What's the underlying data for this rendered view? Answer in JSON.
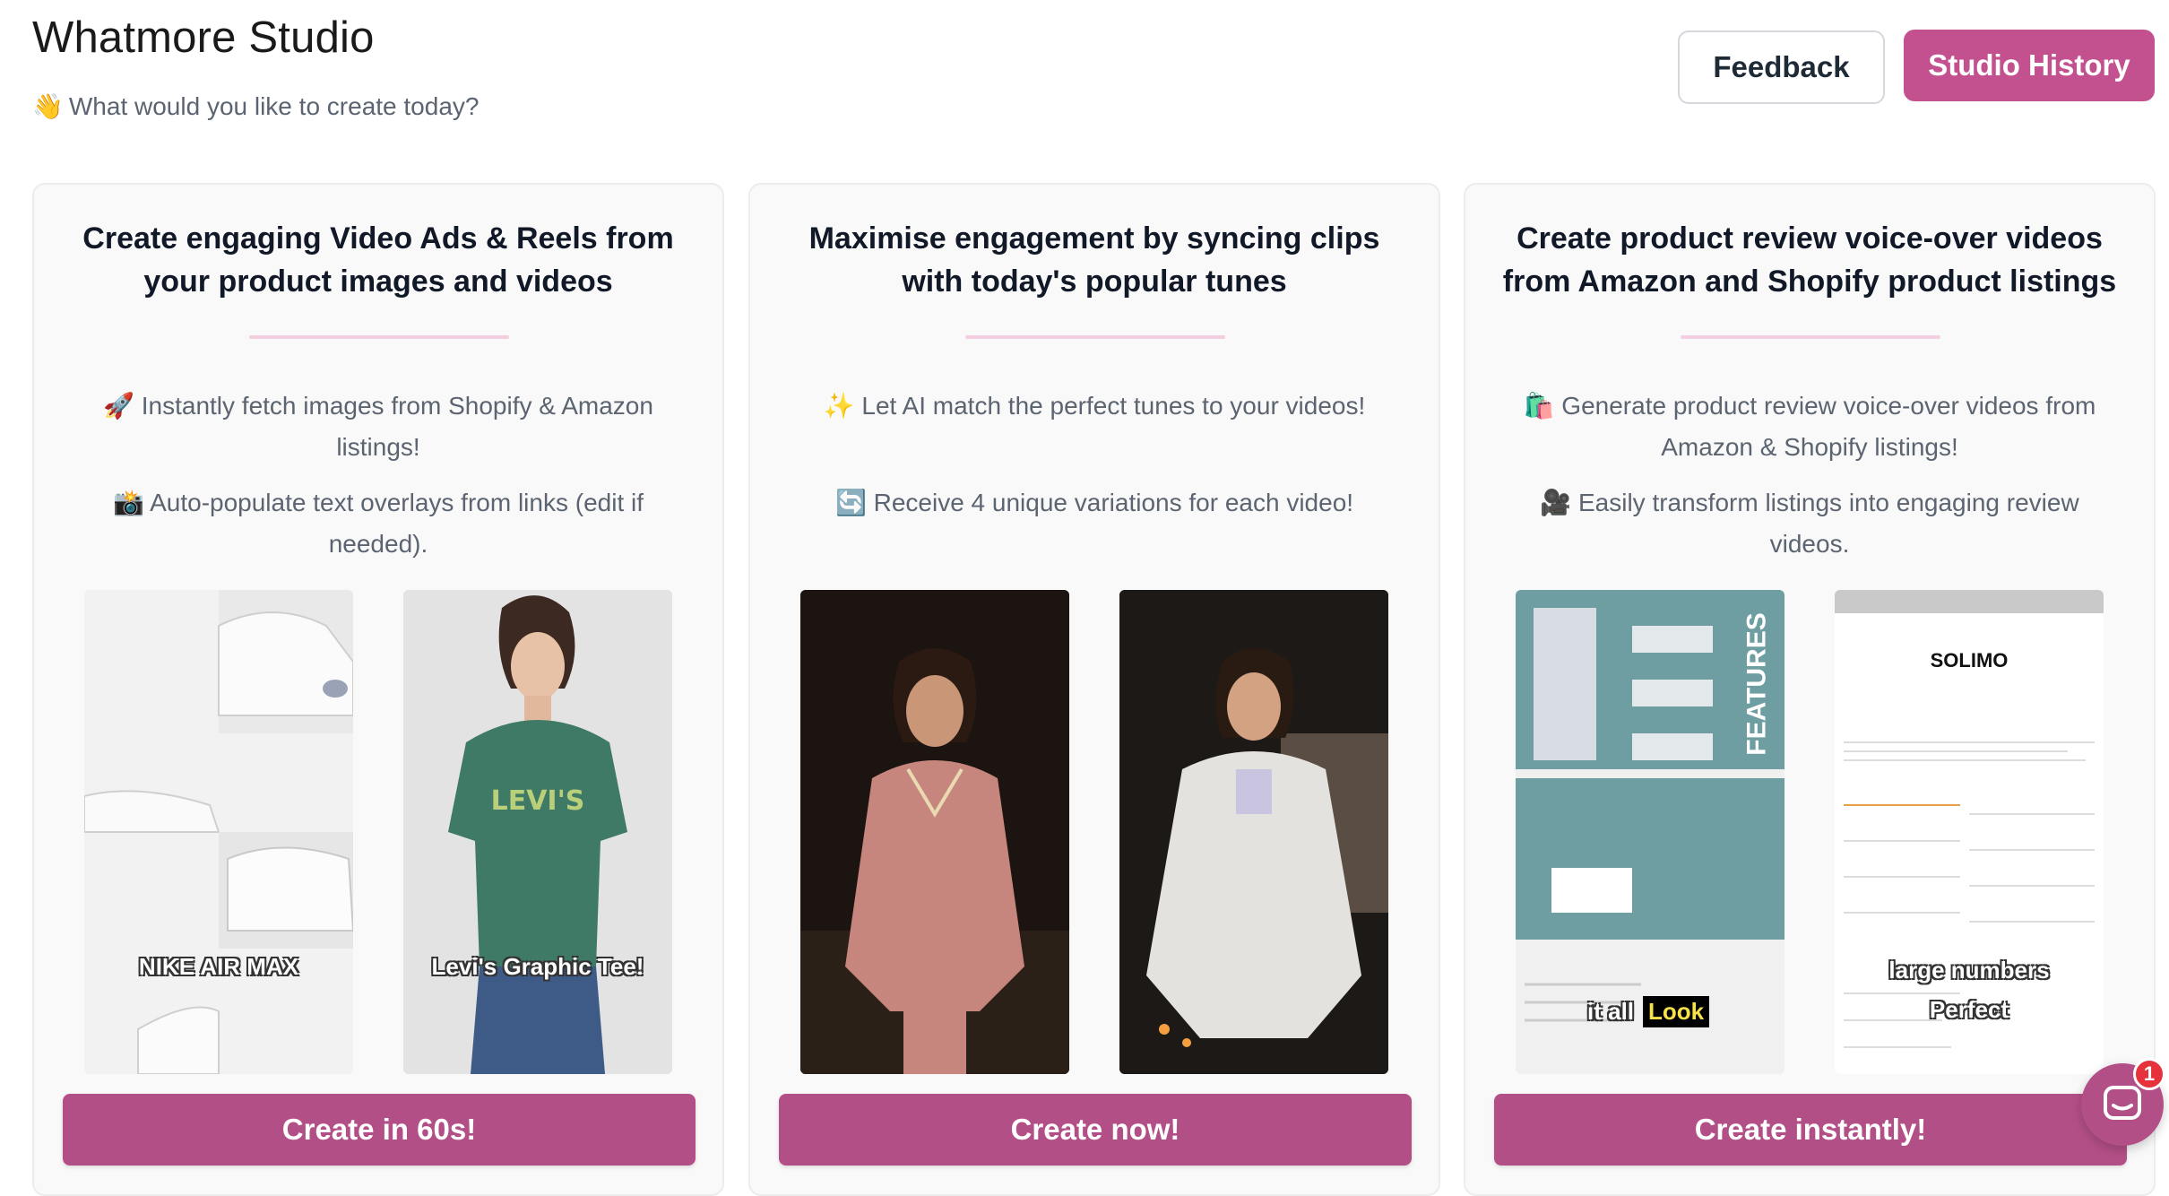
{
  "header": {
    "title": "Whatmore Studio",
    "subtitle_emoji": "👋",
    "subtitle": "What would you like to create today?",
    "feedback_label": "Feedback",
    "history_label": "Studio History"
  },
  "cards": [
    {
      "title": "Create engaging Video Ads & Reels from your product images and videos",
      "features": [
        {
          "emoji": "🚀",
          "text": "Instantly fetch images from Shopify & Amazon listings!"
        },
        {
          "emoji": "📸",
          "text": "Auto-populate text overlays from links (edit if needed)."
        }
      ],
      "thumbnails": [
        {
          "caption": "NIKE AIR MAX"
        },
        {
          "caption": "Levi's Graphic Tee!"
        }
      ],
      "cta": "Create in 60s!"
    },
    {
      "title": "Maximise engagement by syncing clips with today's popular tunes",
      "features": [
        {
          "emoji": "✨",
          "text": "Let AI match the perfect tunes to your videos!"
        },
        {
          "emoji": "🔄",
          "text": "Receive 4 unique variations for each video!"
        }
      ],
      "thumbnails": [
        {
          "caption": ""
        },
        {
          "caption": ""
        }
      ],
      "cta": "Create now!"
    },
    {
      "title": "Create product review voice-over videos from Amazon and Shopify product listings",
      "features": [
        {
          "emoji": "🛍️",
          "text": "Generate product review voice-over videos from Amazon & Shopify listings!"
        },
        {
          "emoji": "🎥",
          "text": "Easily transform listings into engaging review videos."
        }
      ],
      "thumbnails": [
        {
          "caption": "it all",
          "highlight": "Look",
          "side_text": "FEATURES"
        },
        {
          "caption": "large numbers",
          "caption2": "Perfect",
          "brand": "SOLIMO"
        }
      ],
      "cta": "Create instantly!"
    }
  ],
  "chat": {
    "badge_count": "1",
    "icon": "chat-bubble-icon"
  },
  "colors": {
    "primary": "#c3508f",
    "cta": "#b34f87",
    "divider": "#f3cde0",
    "badge": "#e5323b"
  }
}
